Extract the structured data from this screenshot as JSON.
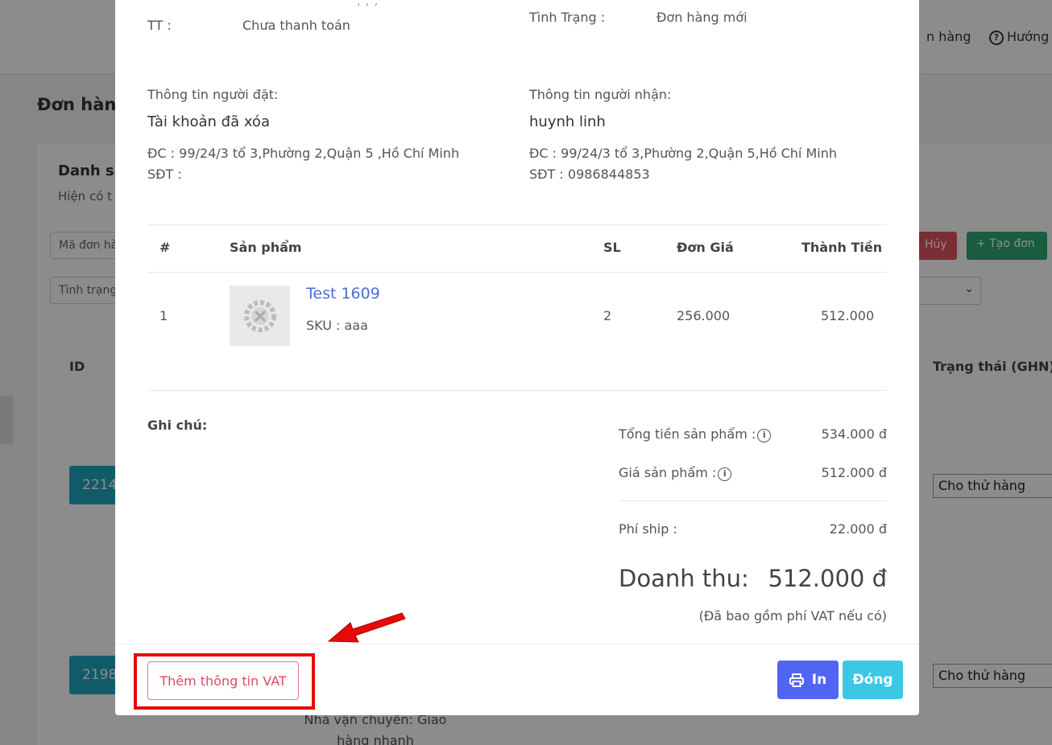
{
  "background": {
    "nav": {
      "orders": "n hàng",
      "help": "Hướng"
    },
    "page_title": "Đơn hàng",
    "card_title": "Danh sá",
    "card_subtitle": "Hiện có t",
    "filter_order_placeholder": "Mã đơn hà",
    "filter_status_placeholder": "Tình trạng",
    "cancel_button": "Hủy",
    "create_button": "Tạo đơn",
    "col_id": "ID",
    "col_status_ghn": "Trạng thái (GHN)",
    "rows": [
      {
        "id": "2214",
        "status": "Cho thử hàng"
      },
      {
        "id": "2198",
        "status": "Cho thử hàng"
      }
    ],
    "shipping_text": "Nhà vận chuyển: Giao hàng nhanh"
  },
  "modal": {
    "payment_label": "TT :",
    "payment_value": "Chưa thanh toán",
    "order_status_label": "Tình Trạng :",
    "order_status_value": "Đơn hàng mới",
    "buyer": {
      "title": "Thông tin người đặt:",
      "name": "Tài khoản đã xóa",
      "address": "ĐC : 99/24/3 tổ 3,Phường 2,Quận 5 ,Hồ Chí Minh",
      "phone": "SĐT :"
    },
    "receiver": {
      "title": "Thông tin người nhận:",
      "name": "huynh linh",
      "address": "ĐC : 99/24/3 tổ 3,Phường 2,Quận 5,Hồ Chí Minh",
      "phone": "SĐT : 0986844853"
    },
    "table": {
      "headers": {
        "index": "#",
        "product": "Sản phẩm",
        "qty": "SL",
        "unit_price": "Đơn Giá",
        "total": "Thành Tiền"
      },
      "rows": [
        {
          "index": "1",
          "name": "Test 1609",
          "sku": "SKU : aaa",
          "qty": "2",
          "unit_price": "256.000",
          "total": "512.000"
        }
      ]
    },
    "note_label": "Ghi chú:",
    "summary": {
      "product_total_label": "Tổng tiền sản phẩm :",
      "product_total_value": "534.000 đ",
      "product_price_label": "Giá sản phẩm :",
      "product_price_value": "512.000 đ",
      "shipping_label": "Phí ship :",
      "shipping_value": "22.000 đ",
      "revenue_label": "Doanh thu:",
      "revenue_value": "512.000 đ",
      "vat_note": "(Đã bao gồm phí VAT nếu có)"
    },
    "buttons": {
      "add_vat": "Thêm thông tin VAT",
      "print": "In",
      "close": "Đóng"
    }
  },
  "colors": {
    "accent_blue": "#5066f3",
    "accent_cyan": "#3cc7e6",
    "vat_button": "#dd4b63",
    "highlight": "#e50b0b",
    "product_link": "#4a6fd1"
  }
}
